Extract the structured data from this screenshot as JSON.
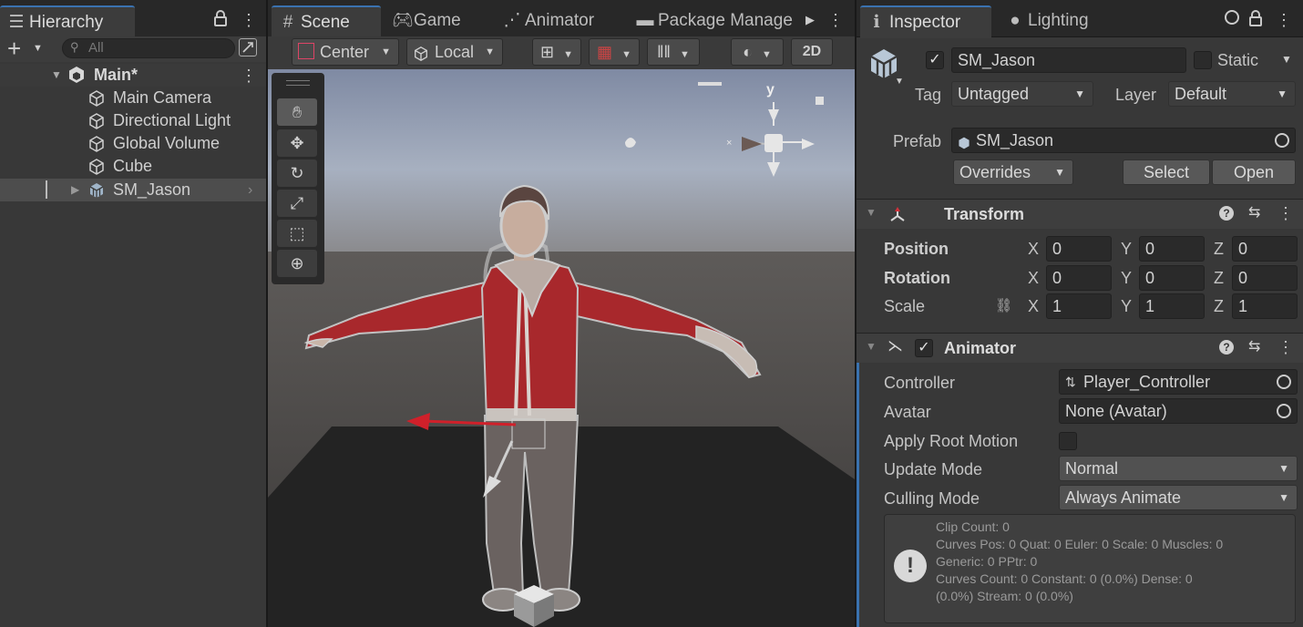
{
  "hierarchy": {
    "tab_label": "Hierarchy",
    "search_placeholder": "All",
    "scene_name": "Main*",
    "items": [
      {
        "label": "Main Camera"
      },
      {
        "label": "Directional Light"
      },
      {
        "label": "Global Volume"
      },
      {
        "label": "Cube"
      },
      {
        "label": "SM_Jason"
      }
    ]
  },
  "center_tabs": {
    "scene": "Scene",
    "game": "Game",
    "animator": "Animator",
    "package_manager": "Package Manage"
  },
  "scene_toolbar": {
    "pivot_mode": "Center",
    "pivot_rotation": "Local",
    "mode_2d": "2D"
  },
  "gizmo": {
    "y_label": "y"
  },
  "inspector": {
    "tab_label": "Inspector",
    "lighting_tab_label": "Lighting",
    "object_name": "SM_Jason",
    "static_label": "Static",
    "tag_label": "Tag",
    "tag_value": "Untagged",
    "layer_label": "Layer",
    "layer_value": "Default",
    "prefab_label": "Prefab",
    "prefab_value": "SM_Jason",
    "overrides_label": "Overrides",
    "select_label": "Select",
    "open_label": "Open",
    "transform": {
      "title": "Transform",
      "position_label": "Position",
      "rotation_label": "Rotation",
      "scale_label": "Scale",
      "x_axis": "X",
      "y_axis": "Y",
      "z_axis": "Z",
      "position": {
        "x": "0",
        "y": "0",
        "z": "0"
      },
      "rotation": {
        "x": "0",
        "y": "0",
        "z": "0"
      },
      "scale": {
        "x": "1",
        "y": "1",
        "z": "1"
      }
    },
    "animator": {
      "title": "Animator",
      "controller_label": "Controller",
      "controller_value": "Player_Controller",
      "avatar_label": "Avatar",
      "avatar_value": "None (Avatar)",
      "apply_root_motion_label": "Apply Root Motion",
      "update_mode_label": "Update Mode",
      "update_mode_value": "Normal",
      "culling_mode_label": "Culling Mode",
      "culling_mode_value": "Always Animate",
      "info_lines": [
        "Clip Count: 0",
        "Curves Pos: 0 Quat: 0 Euler: 0 Scale: 0 Muscles: 0",
        "Generic: 0 PPtr: 0",
        "Curves Count: 0 Constant: 0 (0.0%) Dense: 0",
        "(0.0%) Stream: 0 (0.0%)"
      ]
    }
  },
  "colors": {
    "panel": "#383838",
    "tabbar": "#282828",
    "selection": "#4d4d4d",
    "accent": "#3a72b0",
    "jacket": "#a8282c"
  }
}
